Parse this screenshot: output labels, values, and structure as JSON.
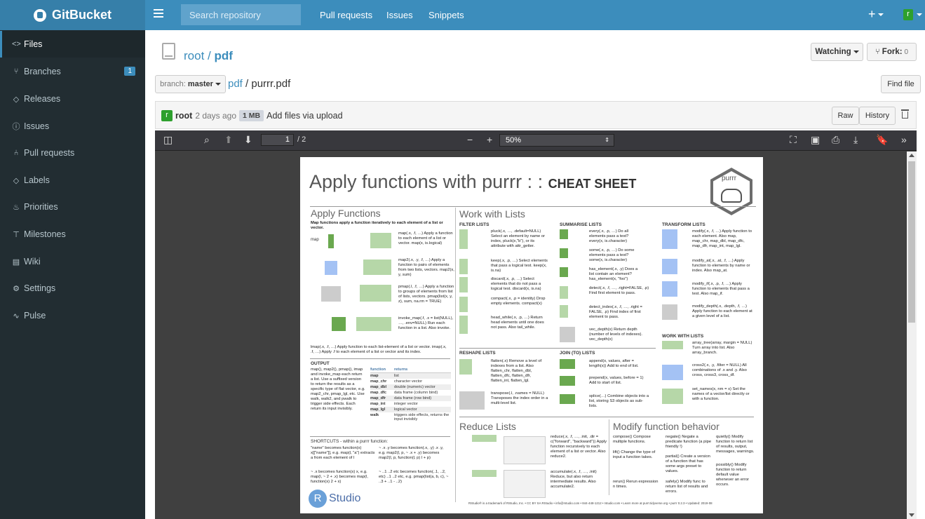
{
  "app": {
    "name": "GitBucket"
  },
  "header": {
    "search_placeholder": "Search repository",
    "nav": [
      "Pull requests",
      "Issues",
      "Snippets"
    ],
    "plus": "+",
    "avatar": "r"
  },
  "sidebar": {
    "items": [
      {
        "label": "Files",
        "icon": "code-icon",
        "glyph": "<>"
      },
      {
        "label": "Branches",
        "icon": "branch-icon",
        "glyph": "⑂",
        "badge": "1"
      },
      {
        "label": "Releases",
        "icon": "tag-icon",
        "glyph": "◇"
      },
      {
        "label": "Issues",
        "icon": "issue-icon",
        "glyph": "ⓘ"
      },
      {
        "label": "Pull requests",
        "icon": "pull-request-icon",
        "glyph": "⑃"
      },
      {
        "label": "Labels",
        "icon": "label-icon",
        "glyph": "◇"
      },
      {
        "label": "Priorities",
        "icon": "flame-icon",
        "glyph": "♨"
      },
      {
        "label": "Milestones",
        "icon": "milestone-icon",
        "glyph": "⊤"
      },
      {
        "label": "Wiki",
        "icon": "book-icon",
        "glyph": "▤"
      },
      {
        "label": "Settings",
        "icon": "gear-icon",
        "glyph": "⚙"
      },
      {
        "label": "Pulse",
        "icon": "pulse-icon",
        "glyph": "∿"
      }
    ]
  },
  "repo": {
    "owner": "root",
    "sep": "/",
    "name": "pdf"
  },
  "actions": {
    "watching": "Watching",
    "fork": "Fork:",
    "fork_count": "0",
    "find_file": "Find file"
  },
  "branch": {
    "label": "branch:",
    "name": "master"
  },
  "path": {
    "dir": "pdf",
    "sep": "/",
    "file": "purrr.pdf"
  },
  "commit": {
    "avatar": "r",
    "author": "root",
    "time": "2 days ago",
    "size": "1 MB",
    "message": "Add files via upload",
    "raw": "Raw",
    "history": "History"
  },
  "pdf_viewer": {
    "page_number": "1",
    "page_total": "/ 2",
    "zoom": "50%",
    "page": {
      "title": "Apply functions with purrr : :",
      "title_bold": "CHEAT SHEET",
      "sections": {
        "apply": "Apply Functions",
        "lists": "Work with Lists",
        "reduce": "Reduce Lists",
        "modify": "Modify function behavior"
      },
      "subsections": {
        "filter": "FILTER LISTS",
        "summarise": "SUMMARISE LISTS",
        "transform": "TRANSFORM LISTS",
        "reshape": "RESHAPE LISTS",
        "join": "JOIN (TO) LISTS",
        "with": "WORK WITH LISTS",
        "output": "OUTPUT",
        "shortcuts": "SHORTCUTS - within a purrr function:"
      },
      "apply_intro": "Map functions apply a function iteratively to each element of a list or vector.",
      "fn_map": "map(.x, .f, …) Apply a function to each element of a list or vector. map(x, is.logical)",
      "fn_map2": "map2(.x, .y, .f, …) Apply a function to pairs of elements from two lists, vectors. map2(x, y, sum)",
      "fn_pmap": "pmap(.l, .f, …) Apply a function to groups of elements from list of lists, vectors. pmap(list(x, y, z), sum, na.rm = TRUE)",
      "fn_imap": "invoke_map(.f, .x = list(NULL), …, .env=NULL) Run each function in a list. Also invoke.",
      "fn_pluck": "pluck(.x, …, .default=NULL) Select an element by name or index, pluck(x,\"b\"), or its attribute with attr_getter.",
      "fn_keep": "keep(.x, .p, …) Select elements that pass a logical test. keep(x, is.na)",
      "fn_discard": "discard(.x, .p, …) Select elements that do not pass a logical test. discard(x, is.na)",
      "fn_compact": "compact(.x, .p = identity) Drop empty elements. compact(x)",
      "fn_headwhile": "head_while(.x, .p, …) Return head elements until one does not pass. Also tail_while.",
      "fn_every": "every(.x, .p, …) Do all elements pass a test? every(x, is.character)",
      "fn_some": "some(.x, .p, …) Do some elements pass a test? some(x, is.character)",
      "fn_has": "has_element(.x, .y) Does a list contain an element? has_element(x, \"foo\")",
      "fn_detect": "detect(.x, .f, …, .right=FALSE, .p) Find first element to pass.",
      "fn_detect_index": "detect_index(.x, .f, …, .right = FALSE, .p) Find index of first element to pass.",
      "fn_vec_depth": "vec_depth(x) Return depth (number of levels of indexes). vec_depth(x)",
      "fn_modify": "modify(.x, .f, …) Apply function to each element. Also map, map_chr, map_dbl, map_dfc, map_dfr, map_int, map_lgl.",
      "fn_modify_at": "modify_at(.x, .at, .f, …) Apply function to elements by name or index. Also map_at.",
      "fn_modify_if": "modify_if(.x, .p, .f, …) Apply function to elements that pass a test. Also map_if.",
      "fn_modify_depth": "modify_depth(.x, .depth, .f, …) Apply function to each element at a given level of a list.",
      "fn_flatten": "flatten(.x) Remove a level of indexes from a list. Also flatten_chr, flatten_dbl, flatten_dfc, flatten_dfr, flatten_int, flatten_lgl.",
      "fn_transpose": "transpose(.l, .names = NULL) Transposes the index order in a multi-level list.",
      "fn_append": "append(x, values, after = length(x)) Add to end of list.",
      "fn_prepend": "prepend(x, values, before = 1) Add to start of list.",
      "fn_splice": "splice(…) Combine objects into a list, storing S3 objects as sub-lists.",
      "fn_array_tree": "array_tree(array, margin = NULL) Turn array into list. Also array_branch.",
      "fn_cross2": "cross2(.x, .y, .filter = NULL) All combinations of .x and .y. Also cross, cross3, cross_df.",
      "fn_set_names": "set_names(x, nm = x) Set the names of a vector/list directly or with a function.",
      "fn_reduce": "reduce(.x, .f, …, .init, .dir = c(\"forward\", \"backward\")) Apply function recursively to each element of a list or vector. Also reduce2.",
      "fn_accumulate": "accumulate(.x, .f, …, .init) Reduce, but also return intermediate results. Also accumulate2.",
      "fn_compose": "compose() Compose multiple functions.",
      "fn_lift": "lift() Change the type of input a function takes.",
      "fn_rerun": "rerun() Rerun expression n times.",
      "fn_negate": "negate() Negate a predicate function (a pipe friendly !)",
      "fn_partial": "partial() Create a version of a function that has some args preset to values.",
      "fn_safely": "safely() Modify func to return list of results and errors.",
      "fn_quietly": "quietly() Modify function to return list of results, output, messages, warnings.",
      "fn_possibly": "possibly() Modify function to return default value whenever an error occurs.",
      "fn_lmap": "lmap(.x, .f, …) Apply function to each list-element of a list or vector. imap(.x, .f, …) Apply .f to each element of a list or vector and its index.",
      "output_text": "map(), map2(), pmap(), imap and invoke_map each return a list. Use a suffixed version to return the results as a specific type of flat vector, e.g. map2_chr, pmap_lgl, etc. Use walk, walk2, and pwalk to trigger side effects. Each return its input invisibly.",
      "output_table": {
        "headers": [
          "function",
          "returns"
        ],
        "rows": [
          [
            "map",
            "list"
          ],
          [
            "map_chr",
            "character vector"
          ],
          [
            "map_dbl",
            "double (numeric) vector"
          ],
          [
            "map_dfc",
            "data frame (column bind)"
          ],
          [
            "map_dfr",
            "data frame (row bind)"
          ],
          [
            "map_int",
            "integer vector"
          ],
          [
            "map_lgl",
            "logical vector"
          ],
          [
            "walk",
            "triggers side effects, returns the input invisibly"
          ]
        ]
      },
      "shortcut_1": "\"name\" becomes function(x) x[[\"name\"]], e.g. map(l, \"a\") extracts a from each element of l",
      "shortcut_2": "~ .x becomes function(x) x, e.g. map(l, ~ 2 + .x) becomes map(l, function(x) 2 + x)",
      "shortcut_3": "~ .x .y becomes function(.x, .y) .x .y, e.g. map2(l, p, ~ .x + .y) becomes map2(l, p, function(l, p) l + p)",
      "shortcut_4": "~ ..1 ..2 etc becomes function(..1, ..2, etc) ..1 ..2 etc, e.g. pmap(list(a, b, c), ~ ..3 + ..1 - ..2)",
      "rstudio_letter": "R",
      "rstudio_word": "Studio",
      "footer": "RStudio® is a trademark of RStudio, Inc. • CC BY SA RStudio • info@rstudio.com • 844-448-1212 • rstudio.com • Learn more at purrr.tidyverse.org • purrr 0.2.3 • Updated: 2019-08",
      "hex_label": "purrr"
    }
  }
}
